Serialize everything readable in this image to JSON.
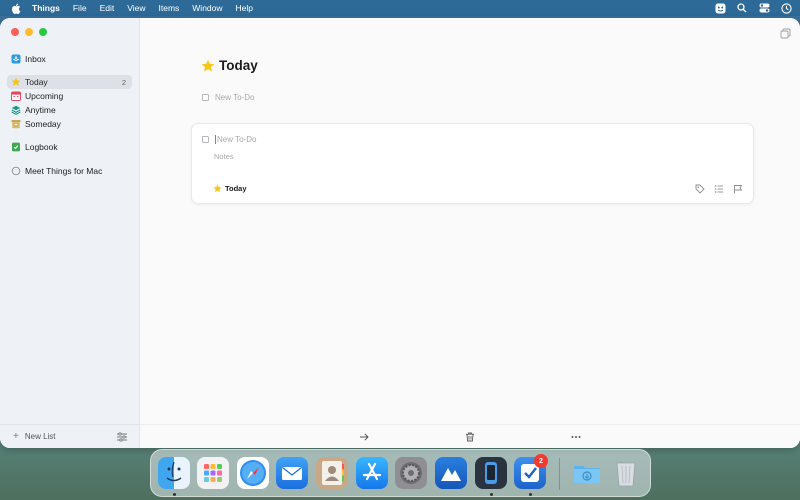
{
  "menubar": {
    "app_name": "Things",
    "items": [
      "File",
      "Edit",
      "View",
      "Items",
      "Window",
      "Help"
    ]
  },
  "sidebar": {
    "items": [
      {
        "label": "Inbox",
        "icon": "inbox-icon",
        "count": ""
      },
      {
        "label": "Today",
        "icon": "star-icon",
        "count": "2",
        "selected": true
      },
      {
        "label": "Upcoming",
        "icon": "calendar-icon",
        "count": ""
      },
      {
        "label": "Anytime",
        "icon": "layers-icon",
        "count": ""
      },
      {
        "label": "Someday",
        "icon": "archive-box-icon",
        "count": ""
      },
      {
        "label": "Logbook",
        "icon": "logbook-icon",
        "count": ""
      },
      {
        "label": "Meet Things for Mac",
        "icon": "circle-icon",
        "count": ""
      }
    ],
    "new_list_label": "New List"
  },
  "main": {
    "title": "Today",
    "new_todo_placeholder": "New To-Do",
    "card": {
      "title_placeholder": "New To-Do",
      "notes_placeholder": "Notes",
      "when_label": "Today"
    }
  },
  "dock": {
    "apps": [
      "Finder",
      "Launchpad",
      "Safari",
      "Mail",
      "Contacts",
      "App Store",
      "System Settings",
      "Instruments",
      "Simulator",
      "Things",
      "Downloads",
      "Trash"
    ],
    "things_badge": "2"
  },
  "colors": {
    "accent": "#4a90e2",
    "today_star": "#f5c518",
    "close": "#fe5f57",
    "minimize": "#febc2e",
    "maximize": "#28c840",
    "menubar": "#2d6a98"
  }
}
